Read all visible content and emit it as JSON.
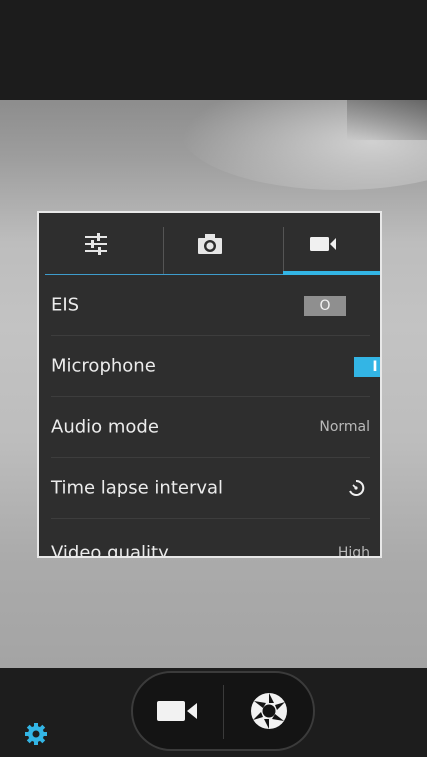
{
  "tabs": [
    {
      "name": "general-settings",
      "icon": "sliders-icon"
    },
    {
      "name": "photo-settings",
      "icon": "camera-icon"
    },
    {
      "name": "video-settings",
      "icon": "video-camera-icon",
      "active": true
    }
  ],
  "settings": {
    "eis": {
      "label": "EIS",
      "state": "off",
      "toggle_glyph": "O"
    },
    "microphone": {
      "label": "Microphone",
      "state": "on",
      "toggle_glyph": "I"
    },
    "audio_mode": {
      "label": "Audio mode",
      "value": "Normal"
    },
    "time_lapse": {
      "label": "Time lapse interval",
      "icon": "timer-icon"
    },
    "video_quality": {
      "label": "Video quality",
      "value": "High"
    }
  },
  "bottom": {
    "settings_icon": "gear-icon",
    "video_mode_icon": "video-camera-icon",
    "shutter_icon": "shutter-icon"
  },
  "colors": {
    "accent": "#33b5e5",
    "panel_bg": "#2e2e2e",
    "toggle_off": "#8f8f8f"
  }
}
